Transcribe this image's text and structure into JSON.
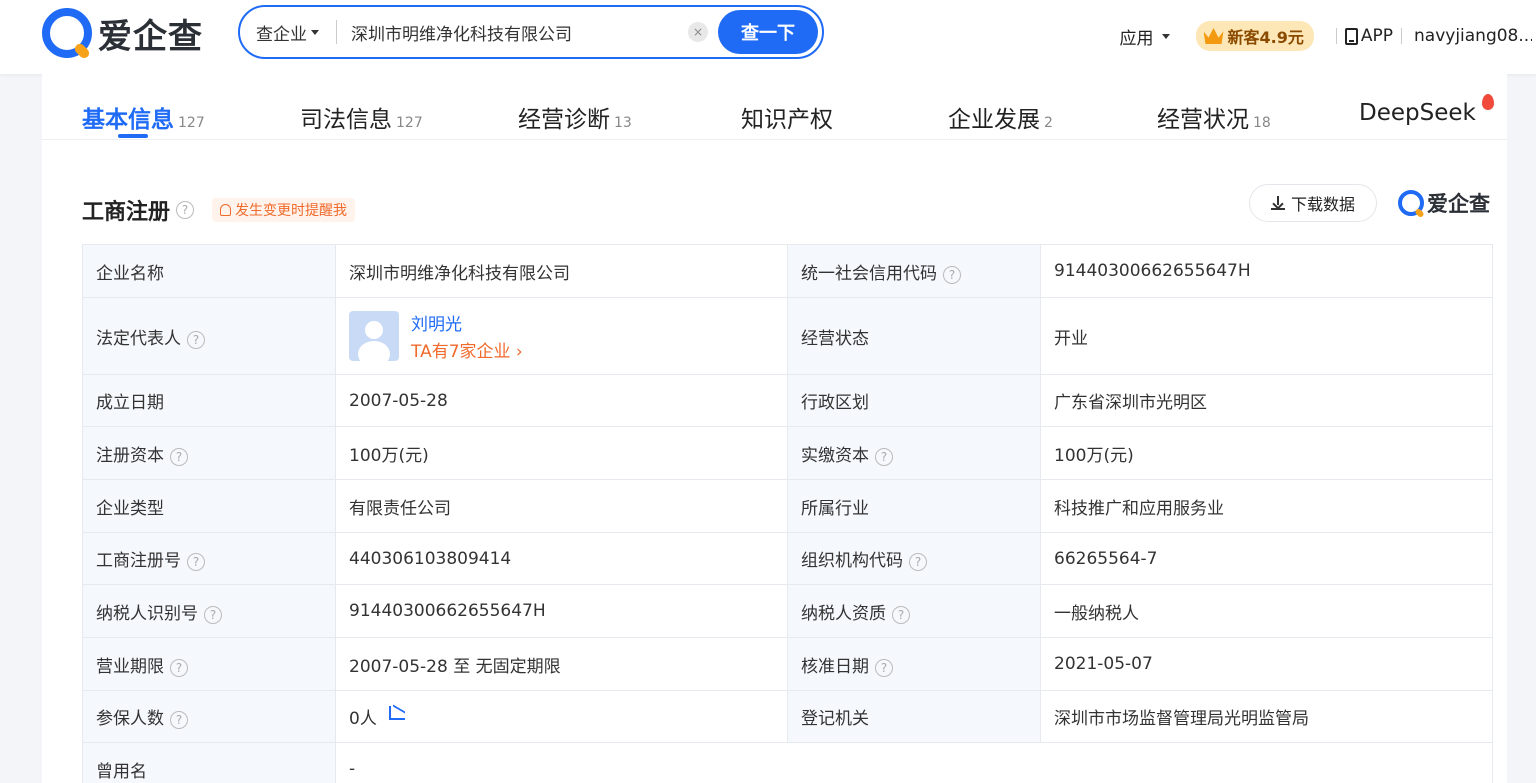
{
  "header": {
    "logo_text": "爱企查",
    "search_scope": "查企业",
    "search_value": "深圳市明维净化科技有限公司",
    "clear_glyph": "×",
    "search_button": "查一下",
    "nav_app": "应用",
    "vip_label": "新客4.9元",
    "app_label": "APP",
    "user": "navyjiang08..."
  },
  "tabs": [
    {
      "label": "基本信息",
      "count": "127"
    },
    {
      "label": "司法信息",
      "count": "127"
    },
    {
      "label": "经营诊断",
      "count": "13"
    },
    {
      "label": "知识产权",
      "count": ""
    },
    {
      "label": "企业发展",
      "count": "2"
    },
    {
      "label": "经营状况",
      "count": "18"
    },
    {
      "label": "DeepSeek",
      "count": ""
    }
  ],
  "section": {
    "title": "工商注册",
    "help_glyph": "?",
    "remind": "发生变更时提醒我",
    "download": "下载数据",
    "brand": "爱企查"
  },
  "rows": {
    "r1": {
      "k1": "企业名称",
      "v1": "深圳市明维净化科技有限公司",
      "k2": "统一社会信用代码",
      "v2": "91440300662655647H"
    },
    "r2": {
      "k1": "法定代表人",
      "v1_name": "刘明光",
      "v1_sub": "TA有7家企业 ›",
      "k2": "经营状态",
      "v2": "开业"
    },
    "r3": {
      "k1": "成立日期",
      "v1": "2007-05-28",
      "k2": "行政区划",
      "v2": "广东省深圳市光明区"
    },
    "r4": {
      "k1": "注册资本",
      "v1": "100万(元)",
      "k2": "实缴资本",
      "v2": "100万(元)"
    },
    "r5": {
      "k1": "企业类型",
      "v1": "有限责任公司",
      "k2": "所属行业",
      "v2": "科技推广和应用服务业"
    },
    "r6": {
      "k1": "工商注册号",
      "v1": "440306103809414",
      "k2": "组织机构代码",
      "v2": "66265564-7"
    },
    "r7": {
      "k1": "纳税人识别号",
      "v1": "91440300662655647H",
      "k2": "纳税人资质",
      "v2": "一般纳税人"
    },
    "r8": {
      "k1": "营业期限",
      "v1": "2007-05-28 至 无固定期限",
      "k2": "核准日期",
      "v2": "2021-05-07"
    },
    "r9": {
      "k1": "参保人数",
      "v1": "0人",
      "k2": "登记机关",
      "v2": "深圳市市场监督管理局光明监管局"
    },
    "r10": {
      "k1": "曾用名",
      "v1": "-"
    }
  }
}
